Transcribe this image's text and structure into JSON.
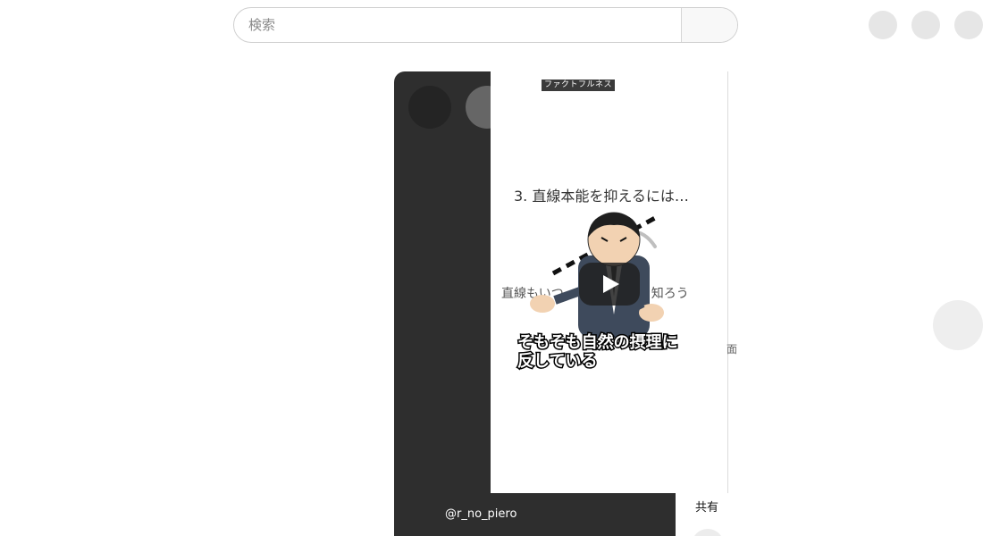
{
  "search": {
    "placeholder": "検索"
  },
  "video": {
    "book_label": "ファクトフルネス",
    "slide_title": "3. 直線本能を抑えるには…",
    "slide_subtitle": "直線もいつ　　　　　とを知ろう",
    "caption_line1": "そもそも自然の摂理に",
    "caption_line2": "反している",
    "channel": "@r_no_piero",
    "share_label": "共有",
    "side_mark": "面"
  },
  "colors": {
    "dark_panel": "#2e2e2e",
    "suit": "#3e4a5c",
    "skin": "#f2d2b2",
    "hair": "#1f1f1f"
  },
  "icons": {
    "play": "play-icon",
    "illustration": "businessman-illustration"
  }
}
